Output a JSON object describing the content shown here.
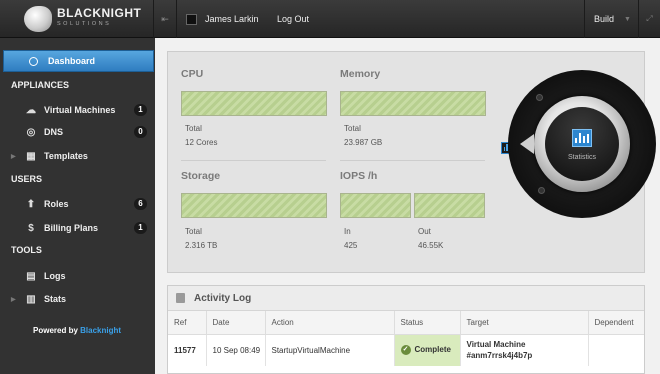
{
  "topbar": {
    "logo_text": "BLACKNIGHT",
    "logo_sub": "SOLUTIONS",
    "user_name": "James Larkin",
    "logout_label": "Log Out",
    "build_label": "Build"
  },
  "sidebar": {
    "active_item": "Dashboard",
    "sections": {
      "appliances": "APPLIANCES",
      "users": "USERS",
      "tools": "TOOLS"
    },
    "items": {
      "virtual_machines": {
        "label": "Virtual Machines",
        "count": "1"
      },
      "dns": {
        "label": "DNS",
        "count": "0"
      },
      "templates": {
        "label": "Templates"
      },
      "roles": {
        "label": "Roles",
        "count": "6"
      },
      "billing_plans": {
        "label": "Billing Plans",
        "count": "1"
      },
      "logs": {
        "label": "Logs"
      },
      "stats": {
        "label": "Stats"
      }
    },
    "powered_by": "Powered by",
    "powered_brand": "Blacknight"
  },
  "stats": {
    "cpu": {
      "title": "CPU",
      "label": "Total",
      "value": "12 Cores"
    },
    "memory": {
      "title": "Memory",
      "label": "Total",
      "value": "23.987 GB"
    },
    "storage": {
      "title": "Storage",
      "label": "Total",
      "value": "2.316 TB"
    },
    "iops": {
      "title": "IOPS /h",
      "in_label": "In",
      "in_value": "425",
      "out_label": "Out",
      "out_value": "46.55K"
    },
    "dial_label": "Statistics"
  },
  "activity_log": {
    "title": "Activity Log",
    "columns": [
      "Ref",
      "Date",
      "Action",
      "Status",
      "Target",
      "Dependent"
    ],
    "rows": [
      {
        "ref": "11577",
        "date": "10 Sep 08:49",
        "action": "StartupVirtualMachine",
        "status": "Complete",
        "target_line1": "Virtual Machine",
        "target_line2": "#anm7rrsk4j4b7p",
        "dependent": ""
      }
    ]
  },
  "colors": {
    "accent": "#2f7dc0",
    "bar_fill": "#c0d69b",
    "status_complete": "#d9ebbd"
  }
}
